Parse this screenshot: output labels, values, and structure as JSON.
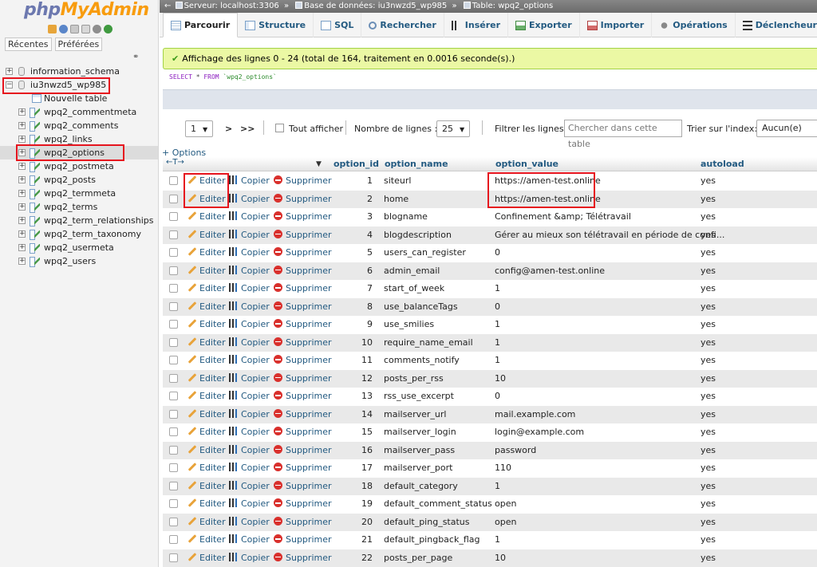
{
  "nav": {
    "logo_php": "php",
    "logo_myadmin": "MyAdmin",
    "icons": [
      "home-icon",
      "info-icon",
      "doc-icon",
      "doc-icon",
      "gear-icon",
      "reload-icon"
    ],
    "recent_label": "Récentes",
    "favorites_label": "Préférées",
    "databases": [
      {
        "name": "information_schema",
        "expanded": false
      },
      {
        "name": "iu3nwzd5_wp985",
        "expanded": true
      }
    ],
    "new_table_label": "Nouvelle table",
    "tables": [
      "wpq2_commentmeta",
      "wpq2_comments",
      "wpq2_links",
      "wpq2_options",
      "wpq2_postmeta",
      "wpq2_posts",
      "wpq2_termmeta",
      "wpq2_terms",
      "wpq2_term_relationships",
      "wpq2_term_taxonomy",
      "wpq2_usermeta",
      "wpq2_users"
    ],
    "selected_table": "wpq2_options"
  },
  "breadcrumb": {
    "server": "Serveur: localhost:3306",
    "database": "Base de données: iu3nwzd5_wp985",
    "table": "Table: wpq2_options",
    "separator": "»"
  },
  "tabs": [
    {
      "label": "Parcourir",
      "icon": "browse-icon",
      "active": true
    },
    {
      "label": "Structure",
      "icon": "structure-icon",
      "active": false
    },
    {
      "label": "SQL",
      "icon": "sql-icon",
      "active": false
    },
    {
      "label": "Rechercher",
      "icon": "search-icon",
      "active": false
    },
    {
      "label": "Insérer",
      "icon": "insert-icon",
      "active": false
    },
    {
      "label": "Exporter",
      "icon": "export-icon",
      "active": false
    },
    {
      "label": "Importer",
      "icon": "import-icon",
      "active": false
    },
    {
      "label": "Opérations",
      "icon": "operations-icon",
      "active": false
    },
    {
      "label": "Déclencheurs",
      "icon": "triggers-icon",
      "active": false
    }
  ],
  "message": {
    "text": "Affichage des lignes 0 - 24 (total de 164, traitement en 0.0016 seconde(s).)",
    "color": "#ebf8a4"
  },
  "sql_query": {
    "select": "SELECT",
    "star": " * ",
    "from": "FROM",
    "table": " `wpq2_options`"
  },
  "controls": {
    "page_value": "1",
    "next": ">",
    "last": ">>",
    "show_all_label": "Tout afficher",
    "rows_label": "Nombre de lignes :",
    "rows_value": "25",
    "filter_label": "Filtrer les lignes :",
    "filter_placeholder": "Chercher dans cette table",
    "sort_label": "Trier sur l'index:",
    "sort_value": "Aucun(e)"
  },
  "table": {
    "options_link": "+ Options",
    "arrows": "←T→",
    "columns": [
      "option_id",
      "option_name",
      "option_value",
      "autoload"
    ],
    "actions": {
      "edit": "Editer",
      "copy": "Copier",
      "delete": "Supprimer"
    },
    "rows": [
      {
        "option_id": "1",
        "option_name": "siteurl",
        "option_value": "https://amen-test.online",
        "autoload": "yes"
      },
      {
        "option_id": "2",
        "option_name": "home",
        "option_value": "https://amen-test.online",
        "autoload": "yes"
      },
      {
        "option_id": "3",
        "option_name": "blogname",
        "option_value": "Confinement &amp; Télétravail",
        "autoload": "yes"
      },
      {
        "option_id": "4",
        "option_name": "blogdescription",
        "option_value": "Gérer au mieux son télétravail en période de confi...",
        "autoload": "yes"
      },
      {
        "option_id": "5",
        "option_name": "users_can_register",
        "option_value": "0",
        "autoload": "yes"
      },
      {
        "option_id": "6",
        "option_name": "admin_email",
        "option_value": "config@amen-test.online",
        "autoload": "yes"
      },
      {
        "option_id": "7",
        "option_name": "start_of_week",
        "option_value": "1",
        "autoload": "yes"
      },
      {
        "option_id": "8",
        "option_name": "use_balanceTags",
        "option_value": "0",
        "autoload": "yes"
      },
      {
        "option_id": "9",
        "option_name": "use_smilies",
        "option_value": "1",
        "autoload": "yes"
      },
      {
        "option_id": "10",
        "option_name": "require_name_email",
        "option_value": "1",
        "autoload": "yes"
      },
      {
        "option_id": "11",
        "option_name": "comments_notify",
        "option_value": "1",
        "autoload": "yes"
      },
      {
        "option_id": "12",
        "option_name": "posts_per_rss",
        "option_value": "10",
        "autoload": "yes"
      },
      {
        "option_id": "13",
        "option_name": "rss_use_excerpt",
        "option_value": "0",
        "autoload": "yes"
      },
      {
        "option_id": "14",
        "option_name": "mailserver_url",
        "option_value": "mail.example.com",
        "autoload": "yes"
      },
      {
        "option_id": "15",
        "option_name": "mailserver_login",
        "option_value": "login@example.com",
        "autoload": "yes"
      },
      {
        "option_id": "16",
        "option_name": "mailserver_pass",
        "option_value": "password",
        "autoload": "yes"
      },
      {
        "option_id": "17",
        "option_name": "mailserver_port",
        "option_value": "110",
        "autoload": "yes"
      },
      {
        "option_id": "18",
        "option_name": "default_category",
        "option_value": "1",
        "autoload": "yes"
      },
      {
        "option_id": "19",
        "option_name": "default_comment_status",
        "option_value": "open",
        "autoload": "yes"
      },
      {
        "option_id": "20",
        "option_name": "default_ping_status",
        "option_value": "open",
        "autoload": "yes"
      },
      {
        "option_id": "21",
        "option_name": "default_pingback_flag",
        "option_value": "1",
        "autoload": "yes"
      },
      {
        "option_id": "22",
        "option_name": "posts_per_page",
        "option_value": "10",
        "autoload": "yes"
      }
    ]
  },
  "colors": {
    "link": "#235a81",
    "annotation": "#e6141e",
    "row_alt": "#e9e9e9"
  }
}
